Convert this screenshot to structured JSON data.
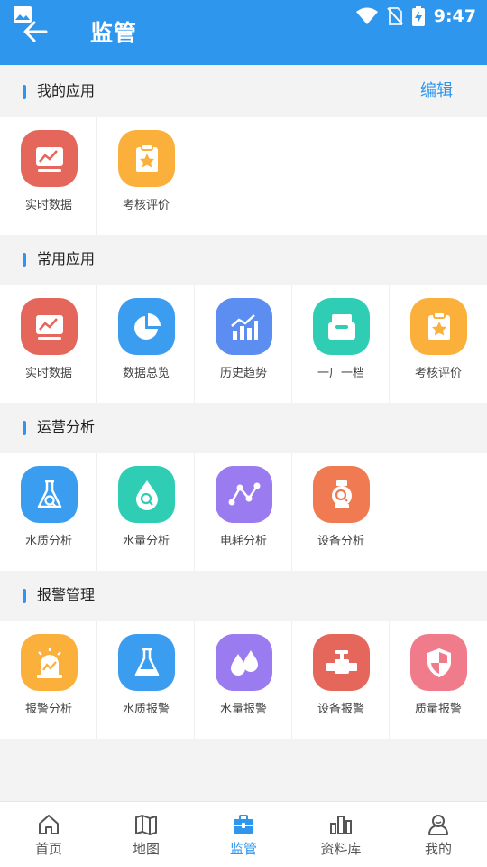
{
  "status_bar": {
    "time": "9:47"
  },
  "header": {
    "title": "监管"
  },
  "colors": {
    "primary": "#2f96ee",
    "red": "#e5675b",
    "orange": "#fbb03b",
    "blue": "#3a9df0",
    "teal": "#2fcdb4",
    "purple": "#9b7cf0",
    "coral": "#f07b52",
    "pink": "#f07b8b",
    "steelblue": "#5b8ef0"
  },
  "sections": {
    "my_apps": {
      "title": "我的应用",
      "edit_label": "编辑",
      "items": [
        {
          "label": "实时数据",
          "icon": "chart-monitor-icon"
        },
        {
          "label": "考核评价",
          "icon": "clipboard-star-icon"
        }
      ]
    },
    "common_apps": {
      "title": "常用应用",
      "items": [
        {
          "label": "实时数据",
          "icon": "chart-monitor-icon"
        },
        {
          "label": "数据总览",
          "icon": "pie-chart-icon"
        },
        {
          "label": "历史趋势",
          "icon": "bar-trend-icon"
        },
        {
          "label": "一厂一档",
          "icon": "inbox-icon"
        },
        {
          "label": "考核评价",
          "icon": "clipboard-star-icon"
        }
      ]
    },
    "analysis": {
      "title": "运营分析",
      "items": [
        {
          "label": "水质分析",
          "icon": "flask-search-icon"
        },
        {
          "label": "水量分析",
          "icon": "drop-search-icon"
        },
        {
          "label": "电耗分析",
          "icon": "node-graph-icon"
        },
        {
          "label": "设备分析",
          "icon": "pump-search-icon"
        }
      ]
    },
    "alarm": {
      "title": "报警管理",
      "items": [
        {
          "label": "报警分析",
          "icon": "alarm-light-icon"
        },
        {
          "label": "水质报警",
          "icon": "flask-icon"
        },
        {
          "label": "水量报警",
          "icon": "drops-icon"
        },
        {
          "label": "设备报警",
          "icon": "valve-icon"
        },
        {
          "label": "质量报警",
          "icon": "shield-icon"
        }
      ]
    }
  },
  "tabbar": {
    "items": [
      {
        "label": "首页",
        "icon": "home-icon"
      },
      {
        "label": "地图",
        "icon": "map-icon"
      },
      {
        "label": "监管",
        "icon": "briefcase-icon"
      },
      {
        "label": "资料库",
        "icon": "library-icon"
      },
      {
        "label": "我的",
        "icon": "profile-icon"
      }
    ],
    "active": "监管"
  }
}
